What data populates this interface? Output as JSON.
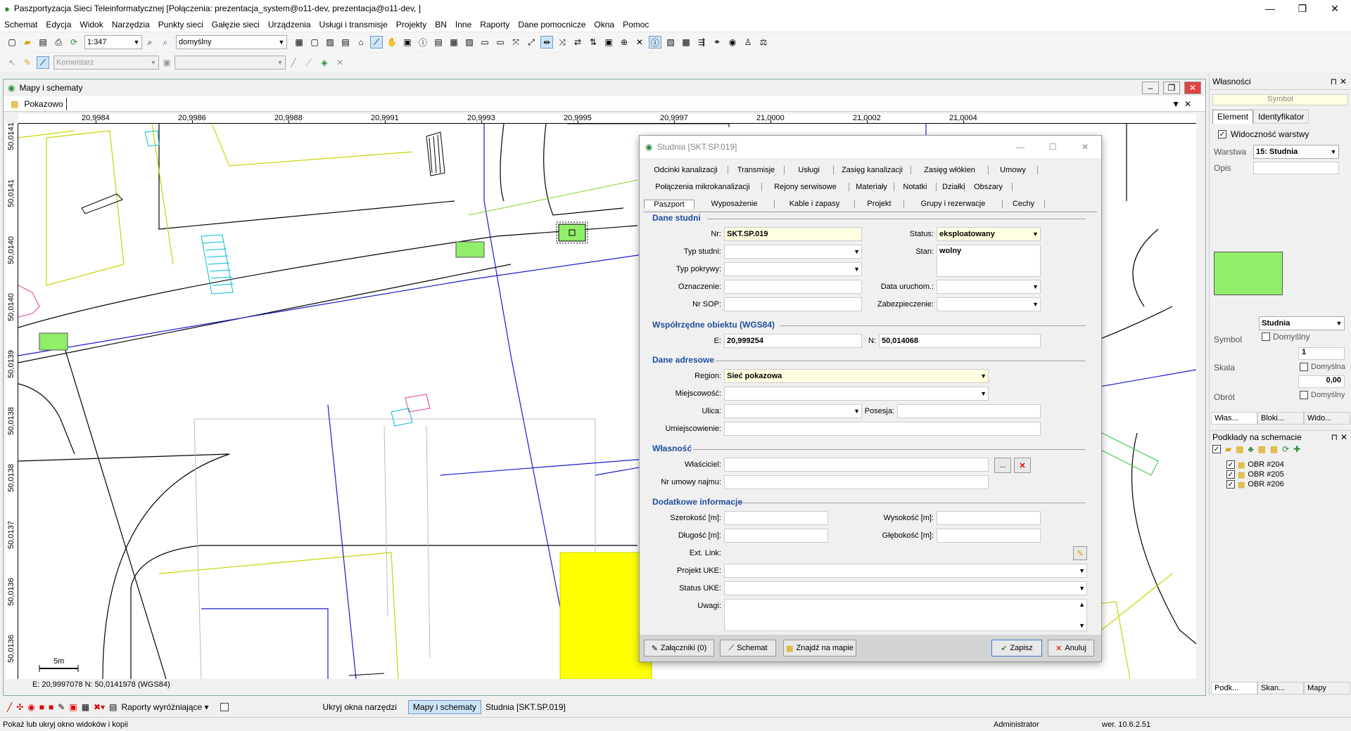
{
  "window": {
    "title": "Paszportyzacja Sieci Teleinformatycznej [Połączenia: prezentacja_system@o11-dev, prezentacja@o11-dev, ]",
    "minimize": "—",
    "maximize": "❐",
    "close": "✕"
  },
  "menu": [
    "Schemat",
    "Edycja",
    "Widok",
    "Narzędzia",
    "Punkty sieci",
    "Gałęzie sieci",
    "Urządzenia",
    "Usługi i transmisje",
    "Projekty",
    "BN",
    "Inne",
    "Raporty",
    "Dane pomocnicze",
    "Okna",
    "Pomoc"
  ],
  "toolbar": {
    "scale": "1:347",
    "style": "domyślny",
    "comment_placeholder": "Komentarz"
  },
  "mapwindow": {
    "title": "Mapy i schematy",
    "tab": "Pokazowo",
    "coords": "E: 20,9997078  N: 50,0141978 (WGS84)",
    "scale_label": "5m",
    "xticks": [
      "20,9984",
      "20,9986",
      "20,9988",
      "20,9991",
      "20,9993",
      "20,9995",
      "20,9997",
      "21,0000",
      "21,0002",
      "21,0004"
    ],
    "yticks": [
      "50,0141",
      "50,0141",
      "50,0140",
      "50,0140",
      "50,0139",
      "50,0138",
      "50,0138",
      "50,0137",
      "50,0136",
      "50,0136"
    ]
  },
  "dialog": {
    "title": "Studnia [SKT.SP.019]",
    "tabs1": [
      "Odcinki kanalizacji",
      "Transmisje",
      "Usługi",
      "Zasięg kanalizacji",
      "Zasięg włókien",
      "Umowy"
    ],
    "tabs2": [
      "Połączenia mikrokanalizacji",
      "Rejony serwisowe",
      "Materiały",
      "Notatki",
      "Działki",
      "Obszary"
    ],
    "tabs3": [
      "Paszport",
      "Wyposażenie",
      "Kable i zapasy",
      "Projekt",
      "Grupy i rezerwacje",
      "Cechy"
    ],
    "sec_dane": "Dane studni",
    "sec_coords": "Współrzędne obiektu (WGS84)",
    "sec_addr": "Dane adresowe",
    "sec_owner": "Własność",
    "sec_extra": "Dodatkowe informacje",
    "l_nr": "Nr:",
    "v_nr": "SKT.SP.019",
    "l_typ": "Typ studni:",
    "l_pokr": "Typ pokrywy:",
    "l_ozn": "Oznaczenie:",
    "l_sop": "Nr SOP:",
    "l_status": "Status:",
    "v_status": "eksploatowany",
    "l_stan": "Stan:",
    "v_stan": "wolny",
    "l_data": "Data uruchom.:",
    "l_zab": "Zabezpieczenie:",
    "l_e": "E:",
    "v_e": "20,999254",
    "l_n": "N:",
    "v_n": "50,014068",
    "l_region": "Region:",
    "v_region": "Sieć pokazowa",
    "l_miej": "Miejscowość:",
    "l_ulica": "Ulica:",
    "l_pos": "Posesja:",
    "l_umiej": "Umiejscowienie:",
    "l_wl": "Właściciel:",
    "l_umowa": "Nr umowy najmu:",
    "more": "...",
    "l_szer": "Szerokość [m]:",
    "l_dl": "Długość [m]:",
    "l_wys": "Wysokość [m]:",
    "l_gl": "Głębokość [m]:",
    "l_ext": "Ext. Link:",
    "l_proj": "Projekt UKE:",
    "l_stuke": "Status UKE:",
    "l_uwagi": "Uwagi:",
    "b_zal": "Załączniki (0)",
    "b_schemat": "Schemat",
    "b_znajdz": "Znajdź na mapie",
    "b_zapisz": "Zapisz",
    "b_anuluj": "Anuluj"
  },
  "props": {
    "title": "Własności",
    "symbol_header": "Symbol",
    "tab_el": "Element",
    "tab_id": "Identyfikator",
    "vis": "Widoczność warstwy",
    "l_warstwa": "Warstwa",
    "v_warstwa": "15: Studnia",
    "l_opis": "Opis",
    "v_symbol": "Studnia",
    "l_symbol": "Symbol",
    "domyslny": "Domyślny",
    "v_skala_n": "1",
    "l_skala": "Skala",
    "domyslna": "Domyślna",
    "v_obrot": "0,00",
    "l_obrot": "Obrót",
    "domyslny2": "Domyślny",
    "tabs": [
      "Włas...",
      "Bloki...",
      "Wido..."
    ],
    "podklady": "Podkłady na schemacie",
    "layers": [
      "OBR #204",
      "OBR #205",
      "OBR #206"
    ],
    "btabs": [
      "Podk...",
      "Skan...",
      "Mapy"
    ]
  },
  "bottombar": {
    "reports": "Raporty wyróżniające",
    "hide": "Ukryj okna narzędzi",
    "win1": "Mapy i schematy",
    "win2": "Studnia [SKT.SP.019]"
  },
  "status": {
    "hint": "Pokaż lub ukryj okno widoków i kopii",
    "user": "Administrator",
    "version": "wer. 10.6.2.51"
  }
}
